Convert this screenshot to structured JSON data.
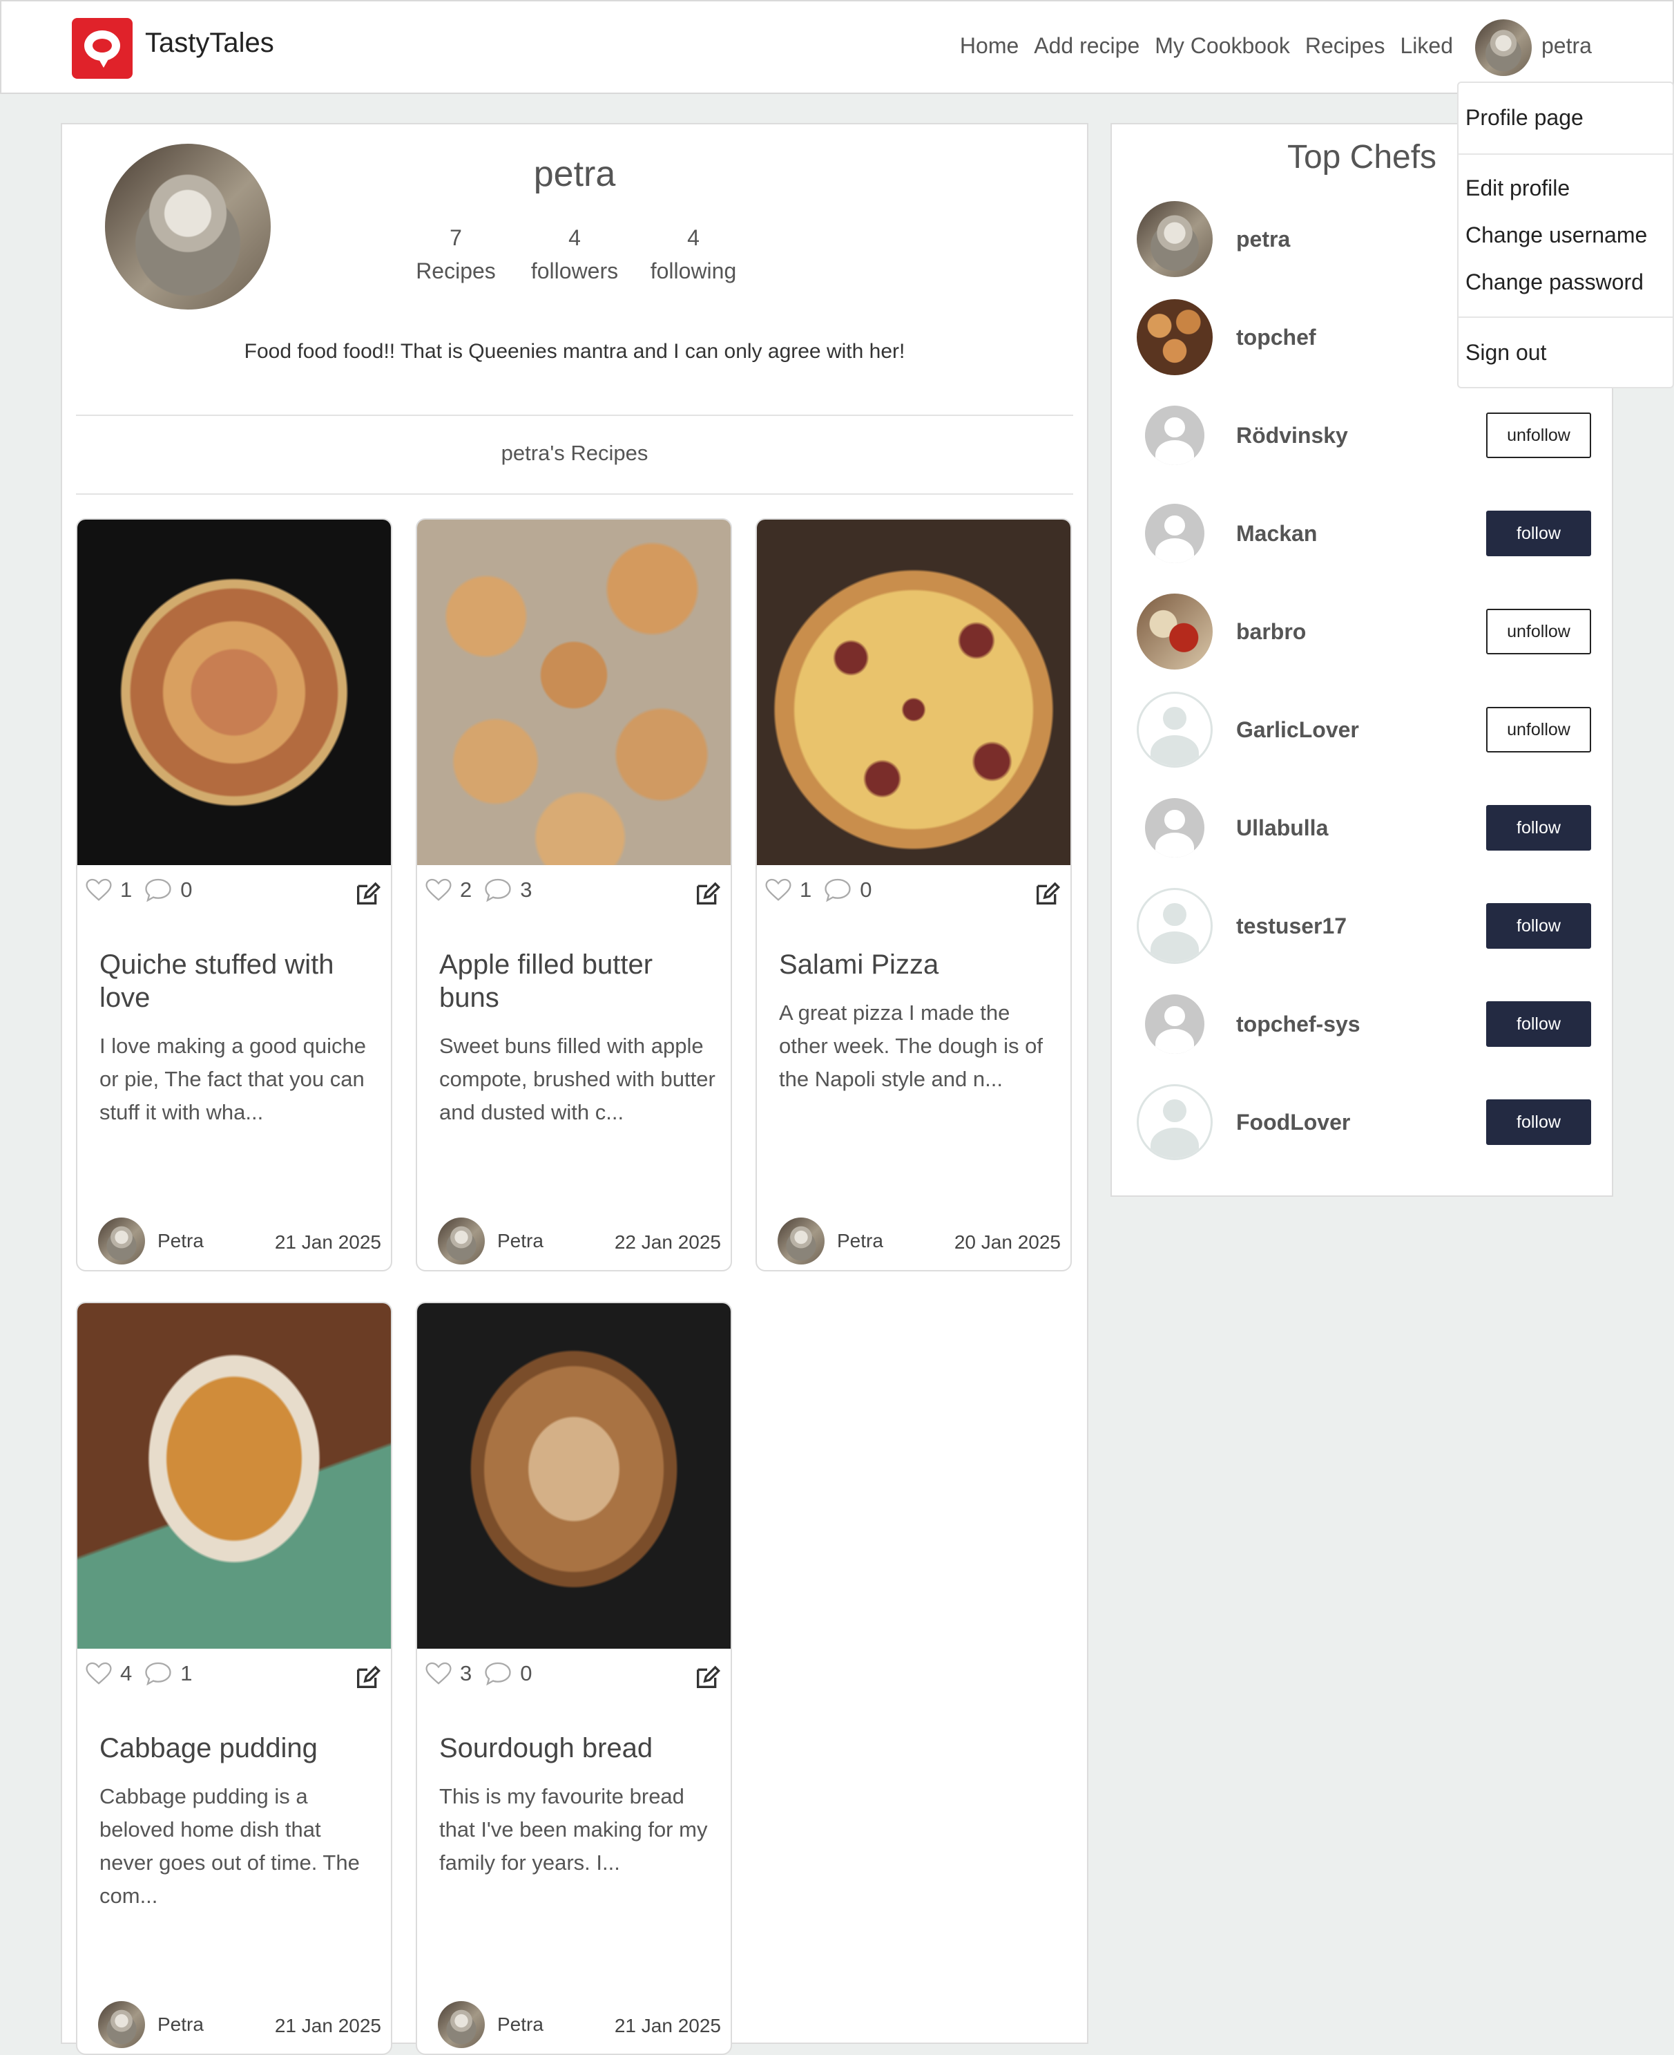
{
  "brand": {
    "name": "TastyTales"
  },
  "nav": {
    "links": [
      "Home",
      "Add recipe",
      "My Cookbook",
      "Recipes",
      "Liked"
    ],
    "username": "petra"
  },
  "dropdown": {
    "items": [
      "Profile page",
      "Edit profile",
      "Change username",
      "Change password",
      "Sign out"
    ]
  },
  "profile": {
    "name": "petra",
    "stats": [
      {
        "value": "7",
        "label": "Recipes"
      },
      {
        "value": "4",
        "label": "followers"
      },
      {
        "value": "4",
        "label": "following"
      }
    ],
    "bio": "Food food food!! That is Queenies mantra and I can only agree with her!",
    "recipes_title": "petra's Recipes"
  },
  "recipes": [
    {
      "likes": "1",
      "comments": "0",
      "title": "Quiche stuffed with love",
      "description": "I love making a good quiche or pie, The fact that you can stuff it with wha...",
      "author": "Petra",
      "date": "21 Jan 2025",
      "image": "quiche-photo"
    },
    {
      "likes": "2",
      "comments": "3",
      "title": "Apple filled butter buns",
      "description": "Sweet buns filled with apple compote, brushed with butter and dusted with c...",
      "author": "Petra",
      "date": "22 Jan 2025",
      "image": "buns-photo"
    },
    {
      "likes": "1",
      "comments": "0",
      "title": "Salami Pizza",
      "description": "A great pizza I made the other week. The dough is of the Napoli style and n...",
      "author": "Petra",
      "date": "20 Jan 2025",
      "image": "pizza-photo"
    },
    {
      "likes": "4",
      "comments": "1",
      "title": "Cabbage pudding",
      "description": "Cabbage pudding is a beloved home dish that never goes out of time. The com...",
      "author": "Petra",
      "date": "21 Jan 2025",
      "image": "cabbage-pudding-photo"
    },
    {
      "likes": "3",
      "comments": "0",
      "title": "Sourdough bread",
      "description": "This is my favourite bread that I've been making for my family for years. I...",
      "author": "Petra",
      "date": "21 Jan 2025",
      "image": "sourdough-photo"
    }
  ],
  "top_chefs": {
    "title": "Top Chefs",
    "chefs": [
      {
        "name": "petra",
        "button": ""
      },
      {
        "name": "topchef",
        "button": ""
      },
      {
        "name": "Rödvinsky",
        "button": "unfollow"
      },
      {
        "name": "Mackan",
        "button": "follow"
      },
      {
        "name": "barbro",
        "button": "unfollow"
      },
      {
        "name": "GarlicLover",
        "button": "unfollow"
      },
      {
        "name": "Ullabulla",
        "button": "follow"
      },
      {
        "name": "testuser17",
        "button": "follow"
      },
      {
        "name": "topchef-sys",
        "button": "follow"
      },
      {
        "name": "FoodLover",
        "button": "follow"
      }
    ]
  },
  "colors": {
    "brand": "#e0222a",
    "follow_button": "#232a42",
    "page_background": "#ecefee"
  },
  "icons": [
    "logo-icon",
    "heart-icon",
    "comment-icon",
    "edit-icon",
    "avatar-icon"
  ]
}
